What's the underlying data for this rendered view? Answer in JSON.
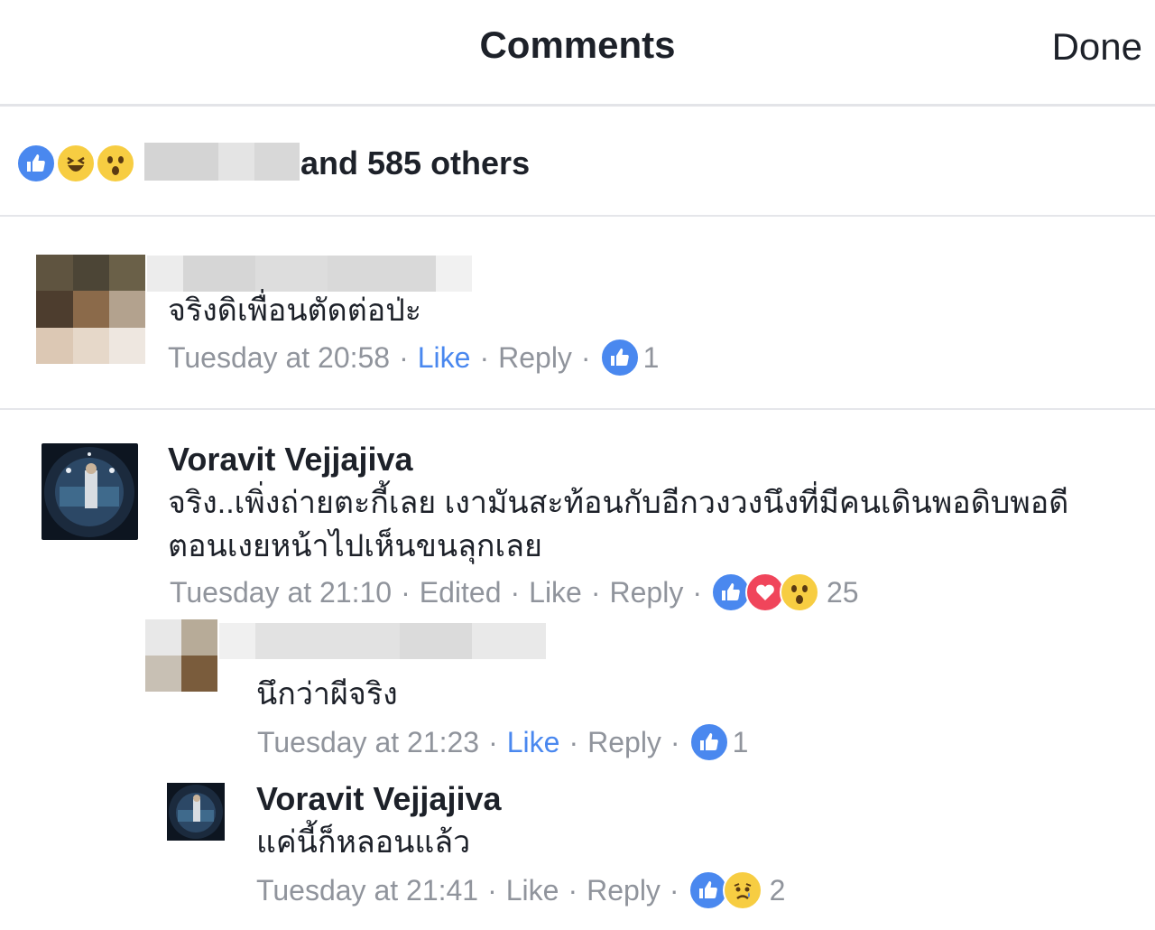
{
  "header": {
    "title": "Comments",
    "done_label": "Done"
  },
  "reactions_summary": {
    "icons": [
      "like-icon",
      "haha-icon",
      "wow-icon"
    ],
    "others_text": "and 585 others"
  },
  "comments": [
    {
      "author": "",
      "text": "จริงดิเพื่อนตัดต่อป่ะ",
      "time": "Tuesday at 20:58",
      "like_label": "Like",
      "reply_label": "Reply",
      "reaction_count": "1",
      "reaction_icons": [
        "like-icon"
      ],
      "liked": true
    },
    {
      "author": "Voravit Vejjajiva",
      "text_line1": "จริง..เพิ่งถ่ายตะกี้เลย เงามันสะท้อนกับอีกวงวงนึงที่มีคนเดินพอดิบพอดี",
      "text_line2": "ตอนเงยหน้าไปเห็นขนลุกเลย",
      "time": "Tuesday at 21:10",
      "edited_label": "Edited",
      "like_label": "Like",
      "reply_label": "Reply",
      "reaction_count": "25",
      "reaction_icons": [
        "like-icon",
        "love-icon",
        "wow-icon"
      ],
      "liked": false
    }
  ],
  "replies": [
    {
      "author": "",
      "text": "นึกว่าผีจริง",
      "time": "Tuesday at 21:23",
      "like_label": "Like",
      "reply_label": "Reply",
      "reaction_count": "1",
      "reaction_icons": [
        "like-icon"
      ],
      "liked": true
    },
    {
      "author": "Voravit Vejjajiva",
      "text": "แค่นี้ก็หลอนแล้ว",
      "time": "Tuesday at 21:41",
      "like_label": "Like",
      "reply_label": "Reply",
      "reaction_count": "2",
      "reaction_icons": [
        "like-icon",
        "sad-icon"
      ],
      "liked": false
    }
  ],
  "colors": {
    "accent": "#4a88ef",
    "meta_gray": "#90949c",
    "love": "#f0455b",
    "emoji_yellow": "#f7cd42"
  }
}
